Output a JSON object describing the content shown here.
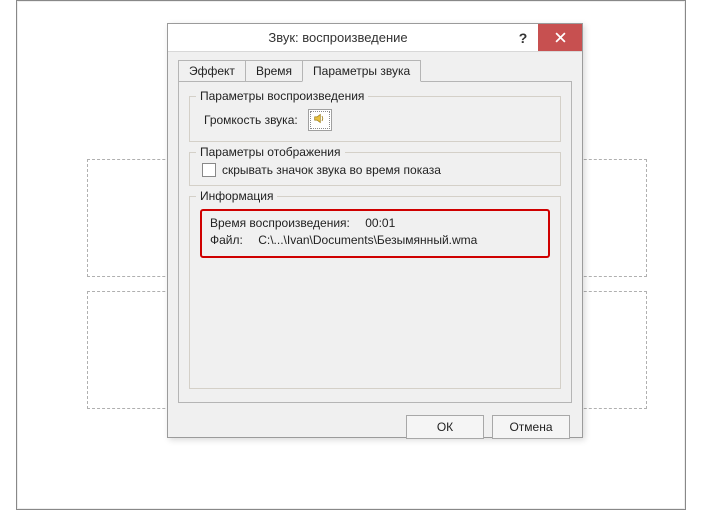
{
  "dialog": {
    "title": "Звук: воспроизведение",
    "help_symbol": "?",
    "tabs": {
      "effect": "Эффект",
      "time": "Время",
      "sound_params": "Параметры звука"
    },
    "playback": {
      "legend": "Параметры воспроизведения",
      "volume_label": "Громкость звука:"
    },
    "display": {
      "legend": "Параметры отображения",
      "hide_icon_label": "скрывать значок звука во время показа"
    },
    "info": {
      "legend": "Информация",
      "play_time_label": "Время воспроизведения:",
      "play_time_value": "00:01",
      "file_label": "Файл:",
      "file_value": "C:\\...\\Ivan\\Documents\\Безымянный.wma"
    },
    "buttons": {
      "ok": "ОК",
      "cancel": "Отмена"
    }
  }
}
